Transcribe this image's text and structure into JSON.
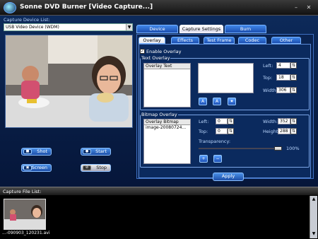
{
  "window": {
    "title": "Sonne DVD Burner [Video Capture...]",
    "minimize": "–",
    "close": "✕"
  },
  "capture": {
    "device_list_label": "Capture Device List:",
    "device_selected": "USB Video Device (WDM)",
    "buttons": {
      "shot": "Shot",
      "start": "Start",
      "full_screen": "Full Screen",
      "stop": "Stop"
    }
  },
  "main_tabs": [
    {
      "label": "Device",
      "active": false
    },
    {
      "label": "Capture Settings",
      "active": true
    },
    {
      "label": "Burn",
      "active": false
    }
  ],
  "sub_tabs": [
    {
      "label": "Overlay",
      "active": true
    },
    {
      "label": "Effects",
      "active": false
    },
    {
      "label": "Test Frame",
      "active": false
    },
    {
      "label": "Codec",
      "active": false
    },
    {
      "label": "Other",
      "active": false
    }
  ],
  "overlay": {
    "enable_label": "Enable Overlay",
    "enabled": true,
    "text_group_title": "Text Overlay",
    "text_list_header": "Overlay Text",
    "left_label": "Left:",
    "left_value": "4",
    "top_label": "Top:",
    "top_value": "18",
    "width_label": "Width:",
    "width_value": "306",
    "font_buttons": [
      "A",
      "A",
      "✷"
    ],
    "bitmap_group_title": "Bitmap Overlay",
    "bitmap_list_header": "Overlay Bitmap",
    "bitmap_item": "image-20080724...",
    "bmp_left_label": "Left:",
    "bmp_left_value": "0",
    "bmp_top_label": "Top:",
    "bmp_top_value": "0",
    "bmp_width_label": "Width:",
    "bmp_width_value": "352",
    "bmp_height_label": "Height",
    "bmp_height_value": "288",
    "transparency_label": "Transparency:",
    "transparency_value": "100%",
    "transparency_fraction": 1.0,
    "apply_label": "Apply"
  },
  "file_list": {
    "label": "Capture File List:",
    "items": [
      {
        "name": "...-090903_120231.avi"
      }
    ]
  },
  "colors": {
    "accent": "#1d4ea8",
    "panel": "#0a2350",
    "checkbox_icon": "✓"
  }
}
